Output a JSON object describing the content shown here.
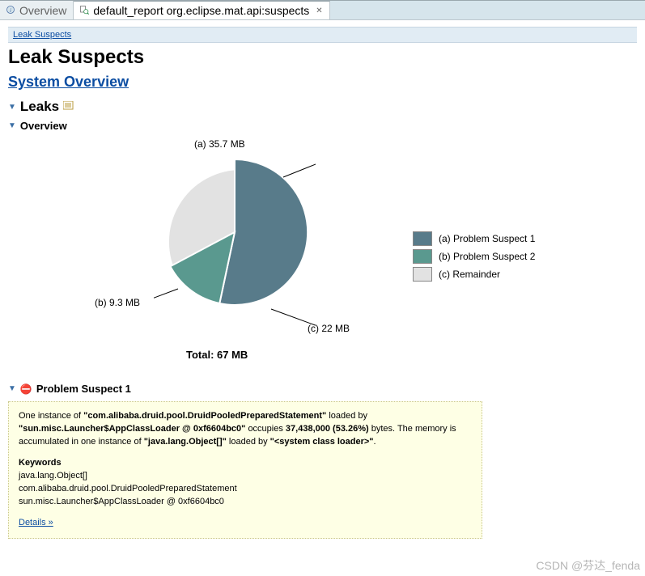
{
  "tabs": {
    "overview_label": "Overview",
    "active_label": "default_report  org.eclipse.mat.api:suspects"
  },
  "breadcrumb": {
    "link_text": "Leak Suspects"
  },
  "page_title": "Leak Suspects",
  "system_overview_link": "System Overview",
  "sections": {
    "leaks_title": "Leaks",
    "overview_title": "Overview"
  },
  "chart_data": {
    "type": "pie",
    "title": "",
    "total_label": "Total: 67 MB",
    "series": [
      {
        "name": "(a) Problem Suspect 1",
        "value_mb": 35.7,
        "label": "(a)  35.7 MB",
        "color": "#587b8a"
      },
      {
        "name": "(b) Problem Suspect 2",
        "value_mb": 9.3,
        "label": "(b)  9.3 MB",
        "color": "#5a998f"
      },
      {
        "name": "(c) Remainder",
        "value_mb": 22.0,
        "label": "(c)  22 MB",
        "color": "#e2e2e2"
      }
    ],
    "legend": [
      "(a)  Problem Suspect 1",
      "(b)  Problem Suspect 2",
      "(c)  Remainder"
    ]
  },
  "problem_suspect": {
    "header": "Problem Suspect 1",
    "text_before_class": "One instance of ",
    "class_name": "\"com.alibaba.druid.pool.DruidPooledPreparedStatement\"",
    "text_loaded_by": " loaded by ",
    "loader": "\"sun.misc.Launcher$AppClassLoader @ 0xf6604bc0\"",
    "text_occupies": " occupies ",
    "bytes": "37,438,000 (53.26%)",
    "text_after_bytes": " bytes. The memory is accumulated in one instance of ",
    "accum_class": "\"java.lang.Object[]\"",
    "text_loaded_by2": " loaded by ",
    "sys_loader": "\"<system class loader>\"",
    "keywords_header": "Keywords",
    "keywords": [
      "java.lang.Object[]",
      "com.alibaba.druid.pool.DruidPooledPreparedStatement",
      "sun.misc.Launcher$AppClassLoader @ 0xf6604bc0"
    ],
    "details_link": "Details »"
  },
  "watermark": "CSDN @芬达_fenda"
}
